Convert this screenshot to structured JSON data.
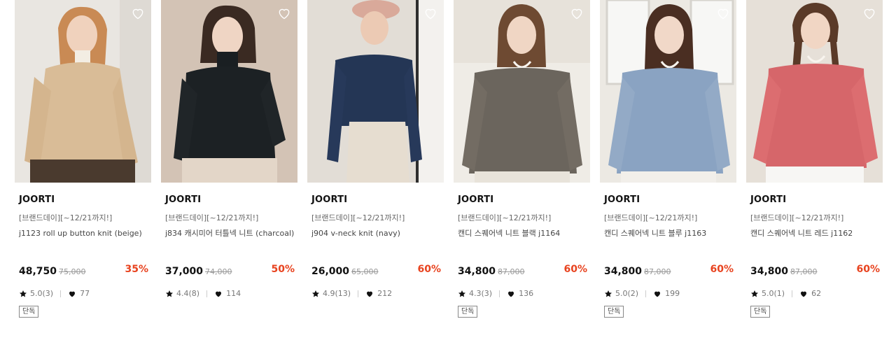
{
  "products": [
    {
      "brand": "JOORTI",
      "promo": "[브랜드데이][~12/21까지!]",
      "name": "j1123 roll up button knit (beige)",
      "price": "48,750",
      "original_price": "75,000",
      "discount": "35%",
      "rating": "5.0(3)",
      "likes": "77",
      "badge": "단독"
    },
    {
      "brand": "JOORTI",
      "promo": "[브랜드데이][~12/21까지!]",
      "name": "j834 캐시미어 터틀넥 니트 (charcoal)",
      "price": "37,000",
      "original_price": "74,000",
      "discount": "50%",
      "rating": "4.4(8)",
      "likes": "114",
      "badge": ""
    },
    {
      "brand": "JOORTI",
      "promo": "[브랜드데이][~12/21까지!]",
      "name": "j904 v-neck knit (navy)",
      "price": "26,000",
      "original_price": "65,000",
      "discount": "60%",
      "rating": "4.9(13)",
      "likes": "212",
      "badge": ""
    },
    {
      "brand": "JOORTI",
      "promo": "[브랜드데이][~12/21까지!]",
      "name": "캔디 스퀘어넥 니트 블랙 j1164",
      "price": "34,800",
      "original_price": "87,000",
      "discount": "60%",
      "rating": "4.3(3)",
      "likes": "136",
      "badge": "단독"
    },
    {
      "brand": "JOORTI",
      "promo": "[브랜드데이][~12/21까지!]",
      "name": "캔디 스퀘어넥 니트 블루 j1163",
      "price": "34,800",
      "original_price": "87,000",
      "discount": "60%",
      "rating": "5.0(2)",
      "likes": "199",
      "badge": "단독"
    },
    {
      "brand": "JOORTI",
      "promo": "[브랜드데이][~12/21까지!]",
      "name": "캔디 스퀘어넥 니트 레드 j1162",
      "price": "34,800",
      "original_price": "87,000",
      "discount": "60%",
      "rating": "5.0(1)",
      "likes": "62",
      "badge": "단독"
    }
  ],
  "colors": {
    "discount": "#e8431f",
    "text": "#111111",
    "muted": "#999999"
  },
  "icons": {
    "wishlist": "heart-outline-icon",
    "rating": "star-icon",
    "likes": "heart-icon"
  }
}
